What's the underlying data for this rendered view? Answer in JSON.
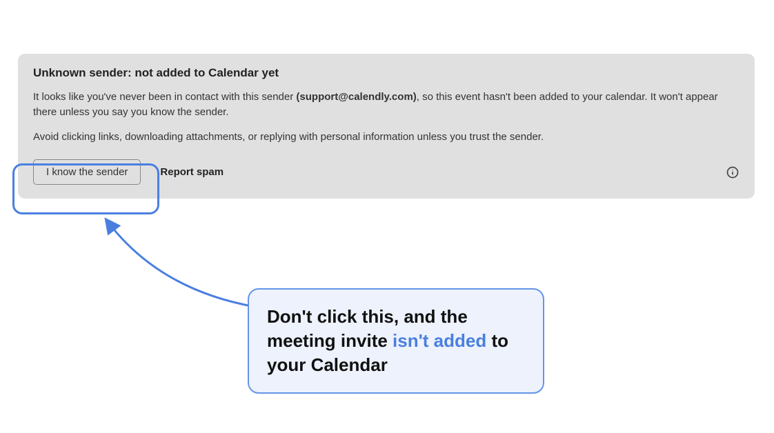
{
  "banner": {
    "title": "Unknown sender: not added to Calendar yet",
    "body_prefix": "It looks like you've never been in contact with this sender ",
    "sender_email": "(support@calendly.com)",
    "body_suffix": ", so this event hasn't been added to your calendar. It won't appear there unless you say you know the sender.",
    "warning": "Avoid clicking links, downloading attachments, or replying with personal information unless you trust the sender.",
    "know_sender_label": "I know the sender",
    "report_spam_label": "Report spam"
  },
  "callout": {
    "part1": "Don't click this, and the meeting invite ",
    "highlighted": "isn't added",
    "part2": " to your Calendar"
  },
  "colors": {
    "banner_bg": "#e0e0e0",
    "annotation_blue": "#4a7fe0",
    "callout_bg": "#edf2fc",
    "callout_border": "#6494e8"
  }
}
